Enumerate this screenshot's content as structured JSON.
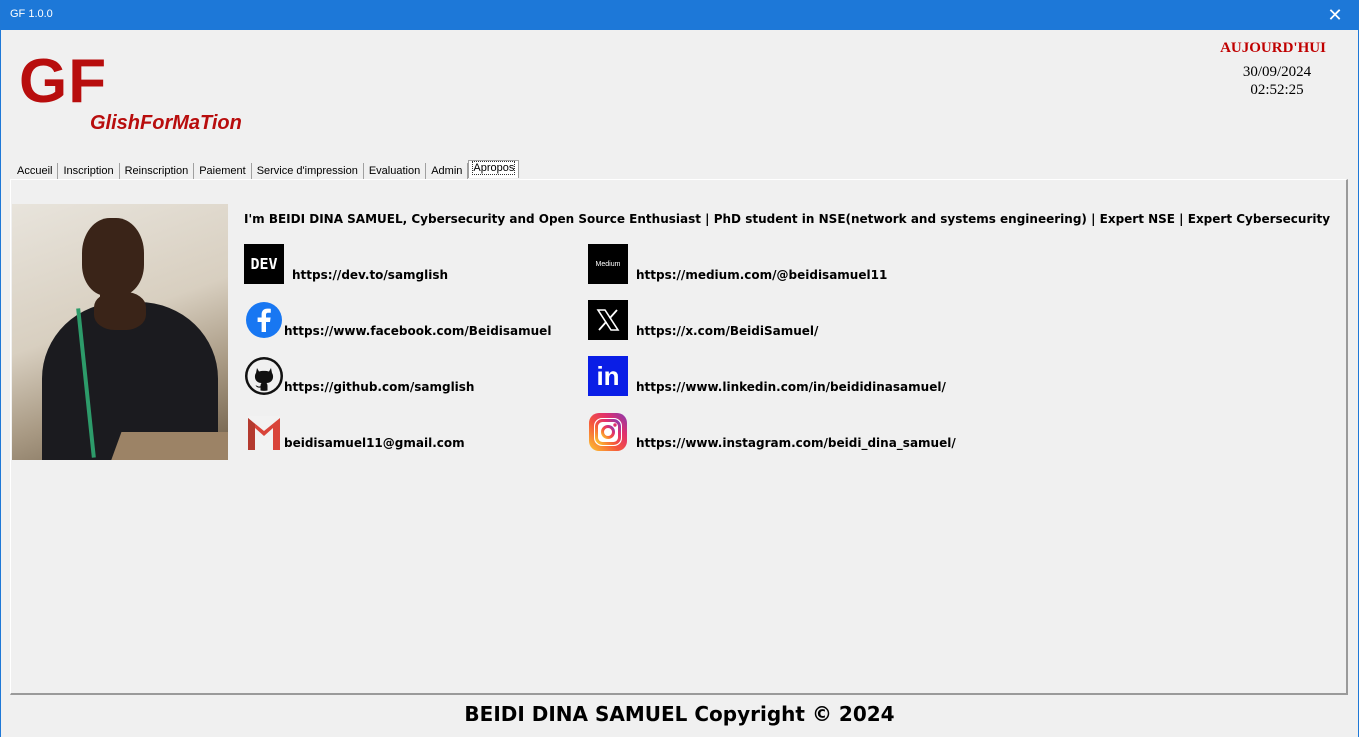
{
  "window": {
    "title": "GF 1.0.0",
    "close_label": "✕"
  },
  "logo": {
    "big": "GF",
    "sub": "GlishForMaTion",
    "color": "#b80d0d"
  },
  "today": {
    "label": "AUJOURD'HUI",
    "date": "30/09/2024",
    "time": "02:52:25"
  },
  "tabs": [
    {
      "label": "Accueil"
    },
    {
      "label": "Inscription"
    },
    {
      "label": "Reinscription"
    },
    {
      "label": "Paiement"
    },
    {
      "label": "Service d'impression"
    },
    {
      "label": "Evaluation"
    },
    {
      "label": "Admin"
    },
    {
      "label": "Apropos",
      "active": true
    }
  ],
  "about": {
    "bio": "I'm BEIDI DINA SAMUEL, Cybersecurity and Open Source Enthusiast |  PhD student in NSE(network and systems engineering) |  Expert NSE | Expert Cybersecurity",
    "links": {
      "dev": {
        "text": "https://dev.to/samglish",
        "icon": "dev-icon",
        "icon_text": "DEV"
      },
      "medium": {
        "text": "https://medium.com/@beidisamuel11",
        "icon": "medium-icon",
        "icon_text": "Medium"
      },
      "facebook": {
        "text": "https://www.facebook.com/Beidisamuel",
        "icon": "facebook-icon"
      },
      "x": {
        "text": "https://x.com/BeidiSamuel/",
        "icon": "x-icon"
      },
      "github": {
        "text": "https://github.com/samglish",
        "icon": "github-icon"
      },
      "linkedin": {
        "text": "https://www.linkedin.com/in/beididinasamuel/",
        "icon": "linkedin-icon",
        "icon_text": "in"
      },
      "gmail": {
        "text": "beidisamuel11@gmail.com",
        "icon": "gmail-icon"
      },
      "instagram": {
        "text": "https://www.instagram.com/beidi_dina_samuel/",
        "icon": "instagram-icon"
      }
    }
  },
  "footer": {
    "text": "BEIDI DINA SAMUEL Copyright © 2024"
  },
  "colors": {
    "titlebar": "#1d78d8",
    "accent_red": "#c00000",
    "facebook": "#1877f2",
    "linkedin": "#0a1ee6"
  }
}
